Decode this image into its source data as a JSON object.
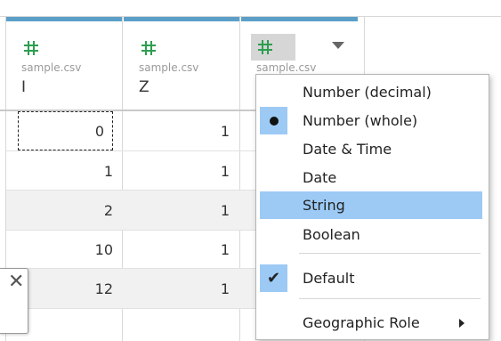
{
  "columns": [
    {
      "source": "sample.csv",
      "name": "I"
    },
    {
      "source": "sample.csv",
      "name": "Z"
    },
    {
      "source": "sample.csv",
      "name": ""
    }
  ],
  "rows": [
    {
      "i": "0",
      "z": "1"
    },
    {
      "i": "1",
      "z": "1"
    },
    {
      "i": "2",
      "z": "1"
    },
    {
      "i": "10",
      "z": "1"
    },
    {
      "i": "12",
      "z": "1"
    }
  ],
  "tooltip": {
    "close": "✕"
  },
  "menu": {
    "items": [
      {
        "label": "Number (decimal)"
      },
      {
        "label": "Number (whole)"
      },
      {
        "label": "Date & Time"
      },
      {
        "label": "Date"
      },
      {
        "label": "String"
      },
      {
        "label": "Boolean"
      }
    ],
    "default_label": "Default",
    "default_check": "✔",
    "geo_label": "Geographic Role"
  },
  "colors": {
    "accent": "#5b9fc9",
    "highlight": "#9ccaf5",
    "number_icon": "#2e9e4f"
  }
}
